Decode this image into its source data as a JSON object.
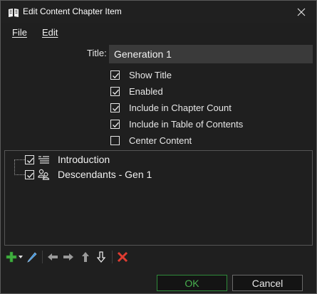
{
  "window": {
    "title": "Edit Content Chapter Item",
    "app_icon": "book-icon",
    "close_icon": "close-icon"
  },
  "menu": {
    "items": [
      {
        "label": "File"
      },
      {
        "label": "Edit"
      }
    ]
  },
  "form": {
    "title_label": "Title:",
    "title_value": "Generation 1",
    "checkboxes": [
      {
        "label": "Show Title",
        "checked": true
      },
      {
        "label": "Enabled",
        "checked": true
      },
      {
        "label": "Include in Chapter Count",
        "checked": true
      },
      {
        "label": "Include in Table of Contents",
        "checked": true
      },
      {
        "label": "Center Content",
        "checked": false
      }
    ]
  },
  "tree": {
    "items": [
      {
        "label": "Introduction",
        "checked": true,
        "icon": "text-lines-icon"
      },
      {
        "label": "Descendants - Gen 1",
        "checked": true,
        "icon": "people-icon"
      }
    ]
  },
  "toolbar": {
    "buttons": [
      {
        "icon": "add-icon"
      },
      {
        "icon": "dropdown-arrow-icon"
      },
      {
        "icon": "edit-pencil-icon"
      },
      {
        "icon": "move-left-icon"
      },
      {
        "icon": "move-right-icon"
      },
      {
        "icon": "move-up-icon"
      },
      {
        "icon": "move-down-icon"
      },
      {
        "icon": "delete-icon"
      }
    ]
  },
  "buttons": {
    "ok": "OK",
    "cancel": "Cancel"
  },
  "colors": {
    "background": "#1f1f1f",
    "ok_text": "#48b04f",
    "delete_red": "#e03c31",
    "add_green": "#3fae3f"
  }
}
